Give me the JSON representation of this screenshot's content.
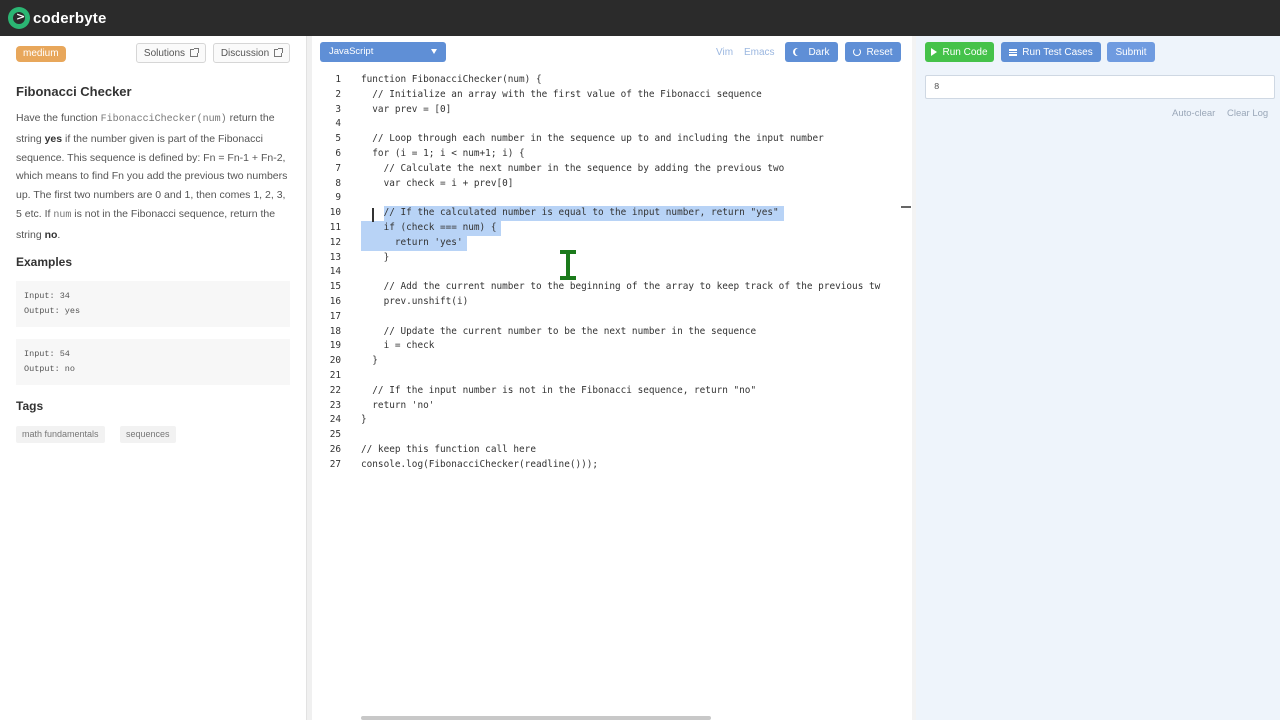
{
  "app": {
    "brand": "coderbyte",
    "logo_glyph": ">"
  },
  "challenge": {
    "difficulty": "medium",
    "solutions_label": "Solutions",
    "discussion_label": "Discussion",
    "title": "Fibonacci Checker",
    "desc": {
      "p1": "Have the function ",
      "fn": "FibonacciChecker(num)",
      "p2": " return the string ",
      "yes": "yes",
      "p3": " if the number given is part of the Fibonacci sequence. This sequence is defined by: Fn = Fn-1 + Fn-2, which means to find Fn you add the previous two numbers up. The first two numbers are 0 and 1, then comes 1, 2, 3, 5 etc. If ",
      "num": "num",
      "p4": " is not in the Fibonacci sequence, return the string ",
      "no": "no",
      "p5": "."
    },
    "examples_heading": "Examples",
    "examples": [
      {
        "input": "Input: 34",
        "output": "Output: yes"
      },
      {
        "input": "Input: 54",
        "output": "Output: no"
      }
    ],
    "tags_heading": "Tags",
    "tags": [
      "math fundamentals",
      "sequences"
    ]
  },
  "editor": {
    "language": "JavaScript",
    "vim_label": "Vim",
    "emacs_label": "Emacs",
    "dark_label": "Dark",
    "reset_label": "Reset",
    "lines": [
      "function FibonacciChecker(num) {",
      "  // Initialize an array with the first value of the Fibonacci sequence",
      "  var prev = [0]",
      "",
      "  // Loop through each number in the sequence up to and including the input number",
      "  for (i = 1; i < num+1; i) {",
      "    // Calculate the next number in the sequence by adding the previous two",
      "    var check = i + prev[0]",
      "",
      "    // If the calculated number is equal to the input number, return \"yes\"",
      "    if (check === num) {",
      "      return 'yes'",
      "    }",
      "",
      "    // Add the current number to the beginning of the array to keep track of the previous tw",
      "    prev.unshift(i)",
      "",
      "    // Update the current number to be the next number in the sequence",
      "    i = check",
      "  }",
      "",
      "  // If the input number is not in the Fibonacci sequence, return \"no\"",
      "  return 'no'",
      "}",
      "",
      "// keep this function call here",
      "console.log(FibonacciChecker(readline()));"
    ],
    "selected_lines": [
      10,
      11,
      12
    ]
  },
  "console": {
    "run_label": "Run Code",
    "test_label": "Run Test Cases",
    "submit_label": "Submit",
    "input_value": "8",
    "auto_clear_label": "Auto-clear",
    "clear_log_label": "Clear Log"
  },
  "colors": {
    "topbar": "#2b2b2b",
    "accent_blue": "#5f8fd6",
    "run_green": "#45c24a",
    "submit_blue": "#6f9be0",
    "difficulty": "#e8a75b",
    "selection": "#b8d3f6",
    "brand_green": "#2bb673"
  }
}
